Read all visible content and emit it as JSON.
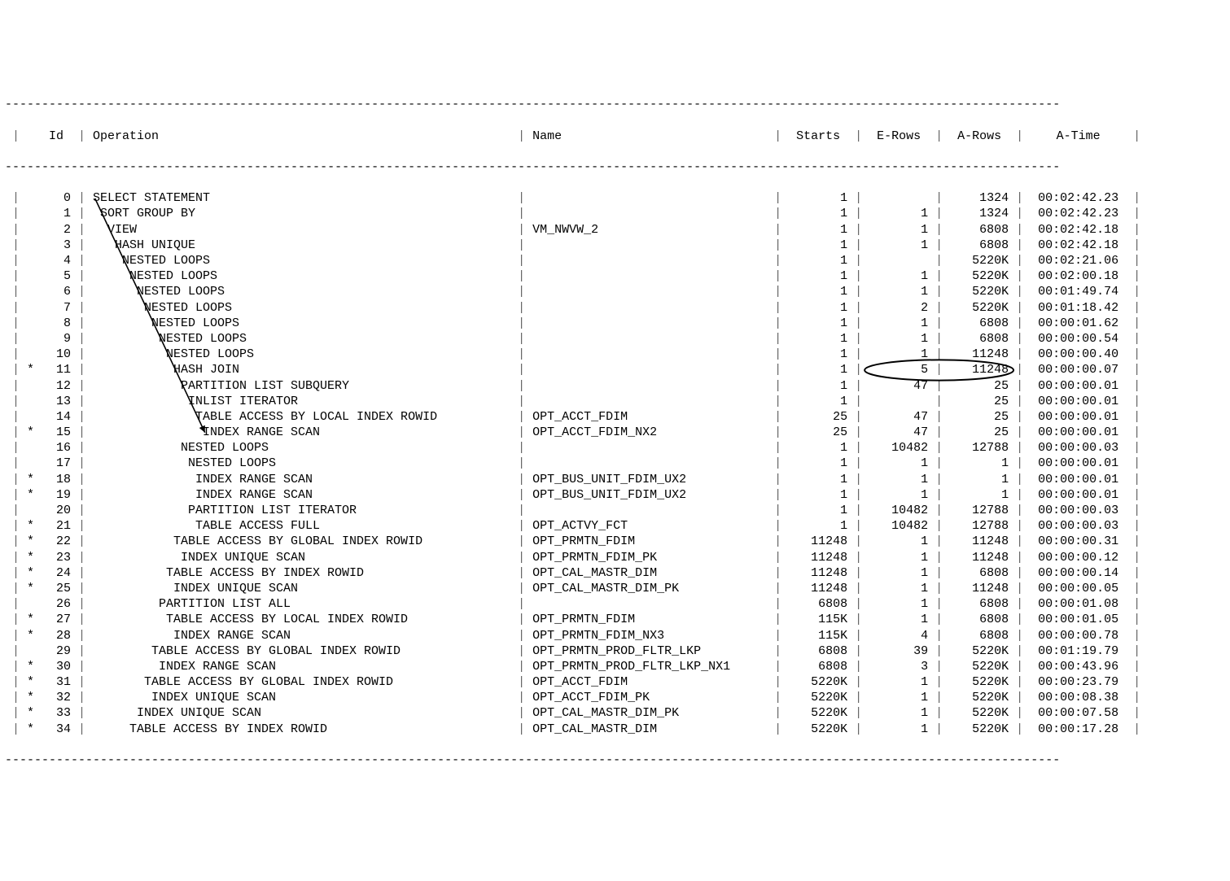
{
  "header": {
    "id": "Id",
    "operation": "Operation",
    "name": "Name",
    "starts": "Starts",
    "erows": "E-Rows",
    "arows": "A-Rows",
    "atime": "A-Time"
  },
  "dash": "------------------------------------------------------------------------------------------------------------------------------------------------",
  "rows": [
    {
      "star": "",
      "id": "0",
      "indent": 0,
      "op": "SELECT STATEMENT",
      "name": "",
      "starts": "1",
      "erows": "",
      "arows": "1324",
      "atime": "00:02:42.23"
    },
    {
      "star": "",
      "id": "1",
      "indent": 1,
      "op": "SORT GROUP BY",
      "name": "",
      "starts": "1",
      "erows": "1",
      "arows": "1324",
      "atime": "00:02:42.23"
    },
    {
      "star": "",
      "id": "2",
      "indent": 2,
      "op": "VIEW",
      "name": "VM_NWVW_2",
      "starts": "1",
      "erows": "1",
      "arows": "6808",
      "atime": "00:02:42.18"
    },
    {
      "star": "",
      "id": "3",
      "indent": 3,
      "op": "HASH UNIQUE",
      "name": "",
      "starts": "1",
      "erows": "1",
      "arows": "6808",
      "atime": "00:02:42.18"
    },
    {
      "star": "",
      "id": "4",
      "indent": 4,
      "op": "NESTED LOOPS",
      "name": "",
      "starts": "1",
      "erows": "",
      "arows": "5220K",
      "atime": "00:02:21.06"
    },
    {
      "star": "",
      "id": "5",
      "indent": 5,
      "op": "NESTED LOOPS",
      "name": "",
      "starts": "1",
      "erows": "1",
      "arows": "5220K",
      "atime": "00:02:00.18"
    },
    {
      "star": "",
      "id": "6",
      "indent": 6,
      "op": "NESTED LOOPS",
      "name": "",
      "starts": "1",
      "erows": "1",
      "arows": "5220K",
      "atime": "00:01:49.74"
    },
    {
      "star": "",
      "id": "7",
      "indent": 7,
      "op": "NESTED LOOPS",
      "name": "",
      "starts": "1",
      "erows": "2",
      "arows": "5220K",
      "atime": "00:01:18.42"
    },
    {
      "star": "",
      "id": "8",
      "indent": 8,
      "op": "NESTED LOOPS",
      "name": "",
      "starts": "1",
      "erows": "1",
      "arows": "6808",
      "atime": "00:00:01.62"
    },
    {
      "star": "",
      "id": "9",
      "indent": 9,
      "op": "NESTED LOOPS",
      "name": "",
      "starts": "1",
      "erows": "1",
      "arows": "6808",
      "atime": "00:00:00.54"
    },
    {
      "star": "",
      "id": "10",
      "indent": 10,
      "op": "NESTED LOOPS",
      "name": "",
      "starts": "1",
      "erows": "1",
      "arows": "11248",
      "atime": "00:00:00.40"
    },
    {
      "star": "*",
      "id": "11",
      "indent": 11,
      "op": "HASH JOIN",
      "name": "",
      "starts": "1",
      "erows": "5",
      "arows": "11248",
      "atime": "00:00:00.07"
    },
    {
      "star": "",
      "id": "12",
      "indent": 12,
      "op": "PARTITION LIST SUBQUERY",
      "name": "",
      "starts": "1",
      "erows": "47",
      "arows": "25",
      "atime": "00:00:00.01"
    },
    {
      "star": "",
      "id": "13",
      "indent": 13,
      "op": "INLIST ITERATOR",
      "name": "",
      "starts": "1",
      "erows": "",
      "arows": "25",
      "atime": "00:00:00.01"
    },
    {
      "star": "",
      "id": "14",
      "indent": 14,
      "op": "TABLE ACCESS BY LOCAL INDEX ROWID",
      "name": "OPT_ACCT_FDIM",
      "starts": "25",
      "erows": "47",
      "arows": "25",
      "atime": "00:00:00.01"
    },
    {
      "star": "*",
      "id": "15",
      "indent": 15,
      "op": "INDEX RANGE SCAN",
      "name": "OPT_ACCT_FDIM_NX2",
      "starts": "25",
      "erows": "47",
      "arows": "25",
      "atime": "00:00:00.01"
    },
    {
      "star": "",
      "id": "16",
      "indent": 12,
      "op": "NESTED LOOPS",
      "name": "",
      "starts": "1",
      "erows": "10482",
      "arows": "12788",
      "atime": "00:00:00.03"
    },
    {
      "star": "",
      "id": "17",
      "indent": 13,
      "op": "NESTED LOOPS",
      "name": "",
      "starts": "1",
      "erows": "1",
      "arows": "1",
      "atime": "00:00:00.01"
    },
    {
      "star": "*",
      "id": "18",
      "indent": 14,
      "op": "INDEX RANGE SCAN",
      "name": "OPT_BUS_UNIT_FDIM_UX2",
      "starts": "1",
      "erows": "1",
      "arows": "1",
      "atime": "00:00:00.01"
    },
    {
      "star": "*",
      "id": "19",
      "indent": 14,
      "op": "INDEX RANGE SCAN",
      "name": "OPT_BUS_UNIT_FDIM_UX2",
      "starts": "1",
      "erows": "1",
      "arows": "1",
      "atime": "00:00:00.01"
    },
    {
      "star": "",
      "id": "20",
      "indent": 13,
      "op": "PARTITION LIST ITERATOR",
      "name": "",
      "starts": "1",
      "erows": "10482",
      "arows": "12788",
      "atime": "00:00:00.03"
    },
    {
      "star": "*",
      "id": "21",
      "indent": 14,
      "op": "TABLE ACCESS FULL",
      "name": "OPT_ACTVY_FCT",
      "starts": "1",
      "erows": "10482",
      "arows": "12788",
      "atime": "00:00:00.03"
    },
    {
      "star": "*",
      "id": "22",
      "indent": 11,
      "op": "TABLE ACCESS BY GLOBAL INDEX ROWID",
      "name": "OPT_PRMTN_FDIM",
      "starts": "11248",
      "erows": "1",
      "arows": "11248",
      "atime": "00:00:00.31"
    },
    {
      "star": "*",
      "id": "23",
      "indent": 12,
      "op": "INDEX UNIQUE SCAN",
      "name": "OPT_PRMTN_FDIM_PK",
      "starts": "11248",
      "erows": "1",
      "arows": "11248",
      "atime": "00:00:00.12"
    },
    {
      "star": "*",
      "id": "24",
      "indent": 10,
      "op": "TABLE ACCESS BY INDEX ROWID",
      "name": "OPT_CAL_MASTR_DIM",
      "starts": "11248",
      "erows": "1",
      "arows": "6808",
      "atime": "00:00:00.14"
    },
    {
      "star": "*",
      "id": "25",
      "indent": 11,
      "op": "INDEX UNIQUE SCAN",
      "name": "OPT_CAL_MASTR_DIM_PK",
      "starts": "11248",
      "erows": "1",
      "arows": "11248",
      "atime": "00:00:00.05"
    },
    {
      "star": "",
      "id": "26",
      "indent": 9,
      "op": "PARTITION LIST ALL",
      "name": "",
      "starts": "6808",
      "erows": "1",
      "arows": "6808",
      "atime": "00:00:01.08"
    },
    {
      "star": "*",
      "id": "27",
      "indent": 10,
      "op": "TABLE ACCESS BY LOCAL INDEX ROWID",
      "name": "OPT_PRMTN_FDIM",
      "starts": "115K",
      "erows": "1",
      "arows": "6808",
      "atime": "00:00:01.05"
    },
    {
      "star": "*",
      "id": "28",
      "indent": 11,
      "op": "INDEX RANGE SCAN",
      "name": "OPT_PRMTN_FDIM_NX3",
      "starts": "115K",
      "erows": "4",
      "arows": "6808",
      "atime": "00:00:00.78"
    },
    {
      "star": "",
      "id": "29",
      "indent": 8,
      "op": "TABLE ACCESS BY GLOBAL INDEX ROWID",
      "name": "OPT_PRMTN_PROD_FLTR_LKP",
      "starts": "6808",
      "erows": "39",
      "arows": "5220K",
      "atime": "00:01:19.79"
    },
    {
      "star": "*",
      "id": "30",
      "indent": 9,
      "op": "INDEX RANGE SCAN",
      "name": "OPT_PRMTN_PROD_FLTR_LKP_NX1",
      "starts": "6808",
      "erows": "3",
      "arows": "5220K",
      "atime": "00:00:43.96"
    },
    {
      "star": "*",
      "id": "31",
      "indent": 7,
      "op": "TABLE ACCESS BY GLOBAL INDEX ROWID",
      "name": "OPT_ACCT_FDIM",
      "starts": "5220K",
      "erows": "1",
      "arows": "5220K",
      "atime": "00:00:23.79"
    },
    {
      "star": "*",
      "id": "32",
      "indent": 8,
      "op": "INDEX UNIQUE SCAN",
      "name": "OPT_ACCT_FDIM_PK",
      "starts": "5220K",
      "erows": "1",
      "arows": "5220K",
      "atime": "00:00:08.38"
    },
    {
      "star": "*",
      "id": "33",
      "indent": 6,
      "op": "INDEX UNIQUE SCAN",
      "name": "OPT_CAL_MASTR_DIM_PK",
      "starts": "5220K",
      "erows": "1",
      "arows": "5220K",
      "atime": "00:00:07.58"
    },
    {
      "star": "*",
      "id": "34",
      "indent": 5,
      "op": "TABLE ACCESS BY INDEX ROWID",
      "name": "OPT_CAL_MASTR_DIM",
      "starts": "5220K",
      "erows": "1",
      "arows": "5220K",
      "atime": "00:00:17.28"
    }
  ],
  "annotations": {
    "circle_row_id": "11",
    "arrow_from_row_id": "0",
    "arrow_to_row_id": "15"
  }
}
